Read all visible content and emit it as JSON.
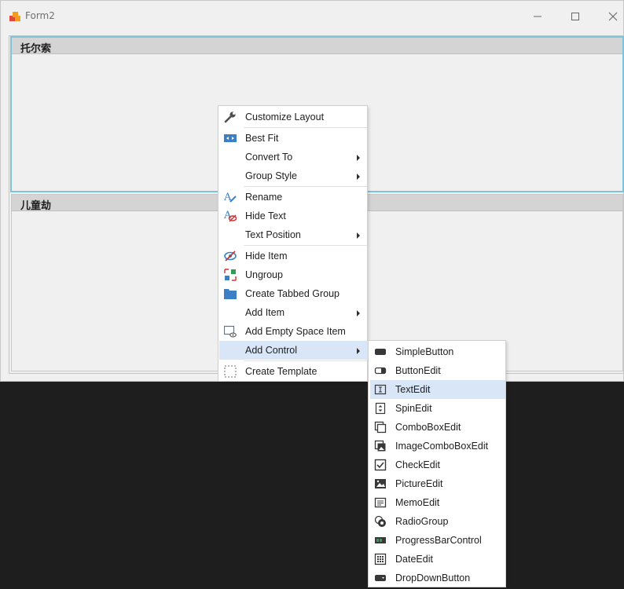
{
  "window": {
    "title": "Form2",
    "buttons": {
      "minimize": "minimize",
      "maximize": "maximize",
      "close": "close"
    }
  },
  "groups": [
    {
      "title": "托尔索"
    },
    {
      "title": "儿童劫"
    }
  ],
  "context_menu": {
    "items": [
      {
        "label": "Customize Layout",
        "icon": "wrench-icon"
      },
      {
        "label": "Best Fit",
        "icon": "best-fit-icon"
      },
      {
        "label": "Convert To",
        "submenu": true
      },
      {
        "label": "Group Style",
        "submenu": true
      },
      {
        "label": "Rename",
        "icon": "rename-icon"
      },
      {
        "label": "Hide Text",
        "icon": "hide-text-icon"
      },
      {
        "label": "Text Position",
        "submenu": true
      },
      {
        "label": "Hide Item",
        "icon": "hide-item-icon"
      },
      {
        "label": "Ungroup",
        "icon": "ungroup-icon"
      },
      {
        "label": "Create Tabbed Group",
        "icon": "folder-icon"
      },
      {
        "label": "Add Item",
        "submenu": true
      },
      {
        "label": "Add Empty Space Item",
        "icon": "empty-space-icon"
      },
      {
        "label": "Add Control",
        "submenu": true,
        "highlighted": true
      },
      {
        "label": "Create Template",
        "icon": "template-icon"
      }
    ]
  },
  "submenu": {
    "highlighted_item": "TextEdit",
    "items": [
      {
        "label": "SimpleButton",
        "icon": "simple-button-icon"
      },
      {
        "label": "ButtonEdit",
        "icon": "button-edit-icon"
      },
      {
        "label": "TextEdit",
        "icon": "text-edit-icon"
      },
      {
        "label": "SpinEdit",
        "icon": "spin-edit-icon"
      },
      {
        "label": "ComboBoxEdit",
        "icon": "combo-box-icon"
      },
      {
        "label": "ImageComboBoxEdit",
        "icon": "image-combo-box-icon"
      },
      {
        "label": "CheckEdit",
        "icon": "check-edit-icon"
      },
      {
        "label": "PictureEdit",
        "icon": "picture-edit-icon"
      },
      {
        "label": "MemoEdit",
        "icon": "memo-edit-icon"
      },
      {
        "label": "RadioGroup",
        "icon": "radio-group-icon"
      },
      {
        "label": "ProgressBarControl",
        "icon": "progress-bar-icon"
      },
      {
        "label": "DateEdit",
        "icon": "date-edit-icon"
      },
      {
        "label": "DropDownButton",
        "icon": "drop-down-button-icon"
      }
    ]
  },
  "colors": {
    "group_selected_border": "#7ec3d8",
    "menu_highlight": "#d8e6f8",
    "dark_background": "#1e1e1e"
  }
}
